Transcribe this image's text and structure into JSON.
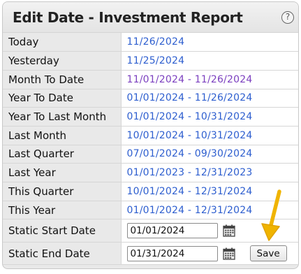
{
  "dialog": {
    "title": "Edit Date - Investment Report",
    "help_glyph": "?"
  },
  "ranges": [
    {
      "label": "Today",
      "value": "11/26/2024",
      "active": false
    },
    {
      "label": "Yesterday",
      "value": "11/25/2024",
      "active": false
    },
    {
      "label": "Month To Date",
      "value": "11/01/2024 - 11/26/2024",
      "active": true
    },
    {
      "label": "Year To Date",
      "value": "01/01/2024 - 11/26/2024",
      "active": false
    },
    {
      "label": "Year To Last Month",
      "value": "01/01/2024 - 10/31/2024",
      "active": false
    },
    {
      "label": "Last Month",
      "value": "10/01/2024 - 10/31/2024",
      "active": false
    },
    {
      "label": "Last Quarter",
      "value": "07/01/2024 - 09/30/2024",
      "active": false
    },
    {
      "label": "Last Year",
      "value": "01/01/2023 - 12/31/2023",
      "active": false
    },
    {
      "label": "This Quarter",
      "value": "10/01/2024 - 12/31/2024",
      "active": false
    },
    {
      "label": "This Year",
      "value": "01/01/2024 - 12/31/2024",
      "active": false
    }
  ],
  "static_start": {
    "label": "Static Start Date",
    "value": "01/01/2024"
  },
  "static_end": {
    "label": "Static End Date",
    "value": "01/31/2024"
  },
  "save_label": "Save",
  "colors": {
    "link": "#2d5ecf",
    "active_link": "#7b3fbf",
    "label_bg": "#e9e9e9",
    "arrow": "#f0b400"
  }
}
